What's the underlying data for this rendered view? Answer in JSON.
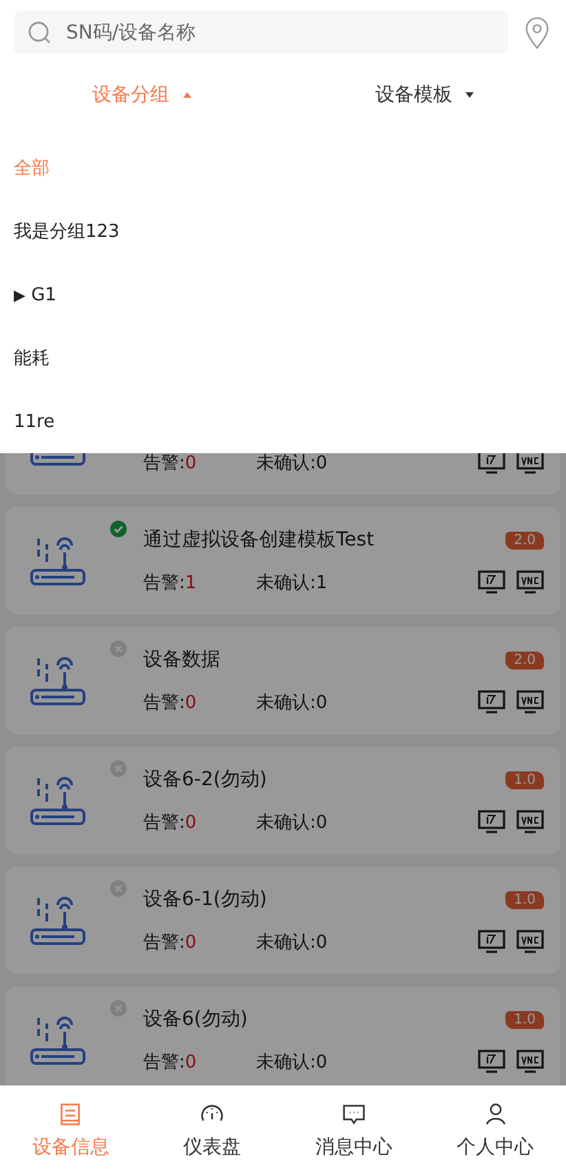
{
  "search": {
    "placeholder": "SN码/设备名称"
  },
  "filters": [
    {
      "label": "设备分组",
      "selected": true,
      "expanded": true
    },
    {
      "label": "设备模板",
      "selected": false,
      "expanded": false
    }
  ],
  "groups": [
    {
      "label": "全部",
      "selected": true,
      "kind": "leaf"
    },
    {
      "label": "我是分组123",
      "selected": false,
      "kind": "leaf"
    },
    {
      "label": "G1",
      "selected": false,
      "kind": "folder",
      "expanded": false,
      "toggle": "▶"
    },
    {
      "label": "能耗",
      "selected": false,
      "kind": "leaf"
    },
    {
      "label": "11re",
      "selected": false,
      "kind": "leaf"
    }
  ],
  "devices": [
    {
      "alarm_label": "告警:",
      "alarms": "0",
      "unconfirmed": "未确认:0"
    },
    {
      "name": "通过虚拟设备创建模板Test",
      "online": true,
      "version": "2.0",
      "alarm_label": "告警:",
      "alarms": "1",
      "unconfirmed": "未确认:1"
    },
    {
      "name": "设备数据",
      "online": false,
      "version": "2.0",
      "alarm_label": "告警:",
      "alarms": "0",
      "unconfirmed": "未确认:0"
    },
    {
      "name": "设备6-2(勿动)",
      "online": false,
      "version": "1.0",
      "alarm_label": "告警:",
      "alarms": "0",
      "unconfirmed": "未确认:0"
    },
    {
      "name": "设备6-1(勿动)",
      "online": false,
      "version": "1.0",
      "alarm_label": "告警:",
      "alarms": "0",
      "unconfirmed": "未确认:0"
    },
    {
      "name": "设备6(勿动)",
      "online": false,
      "version": "1.0",
      "alarm_label": "告警:",
      "alarms": "0",
      "unconfirmed": "未确认:0"
    }
  ],
  "nav": [
    {
      "label": "设备信息",
      "selected": true,
      "kind": "device"
    },
    {
      "label": "仪表盘",
      "selected": false,
      "kind": "gauge"
    },
    {
      "label": "消息中心",
      "selected": false,
      "kind": "message"
    },
    {
      "label": "个人中心",
      "selected": false,
      "kind": "person"
    }
  ]
}
